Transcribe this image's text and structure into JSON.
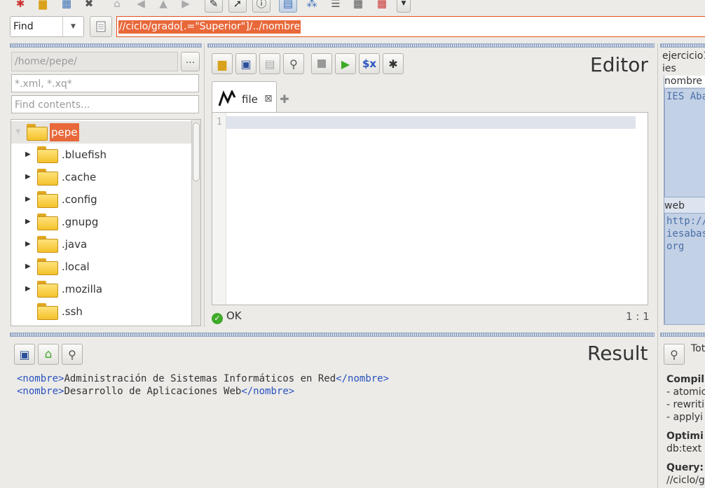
{
  "toolbar": {
    "icons": [
      "new-file-icon",
      "open-folder-icon",
      "table-icon",
      "close-icon",
      "home-icon",
      "back-icon",
      "up-icon",
      "forward-icon",
      "edit-icon",
      "pointer-icon",
      "info-icon",
      "layout-icon",
      "tree-map-icon",
      "list-tree-icon",
      "grid-icon",
      "table-grid-icon",
      "dropdown-icon"
    ]
  },
  "query_bar": {
    "mode": "Find",
    "query": "//ciclo/grado[.=\"Superior\"]/../nombre"
  },
  "file_browser": {
    "path_placeholder": "/home/pepe/",
    "browse_label": "...",
    "filter_placeholder": "*.xml, *.xq*",
    "contents_placeholder": "Find contents...",
    "root": "pepe",
    "items": [
      ".bluefish",
      ".cache",
      ".config",
      ".gnupg",
      ".java",
      ".local",
      ".mozilla",
      ".ssh"
    ]
  },
  "editor": {
    "title": "Editor",
    "tab_label": "file",
    "line_number": "1",
    "status": "OK",
    "cursor": "1 : 1"
  },
  "info_panel": {
    "line1": "ejercicio1",
    "line2": "ies",
    "field1_label": "nombre",
    "field1_value": "IES Abas",
    "field2_label": "web",
    "field2_value_l1": "http://",
    "field2_value_l2": "iesabas",
    "field2_value_l3": "org"
  },
  "result": {
    "title": "Result",
    "lines": [
      {
        "open": "<nombre>",
        "text": "Administración de Sistemas Informáticos en Red",
        "close": "</nombre>"
      },
      {
        "open": "<nombre>",
        "text": "Desarrollo de Aplicaciones Web",
        "close": "</nombre>"
      }
    ]
  },
  "query_info": {
    "header": "Tot",
    "compiling_label": "Compil",
    "compiling_items": [
      "- atomic",
      "- rewriti",
      "- applyi"
    ],
    "optimized_label": "Optimi",
    "optimized_value": "db:text",
    "query_label": "Query:",
    "query_value": "//ciclo/g"
  }
}
